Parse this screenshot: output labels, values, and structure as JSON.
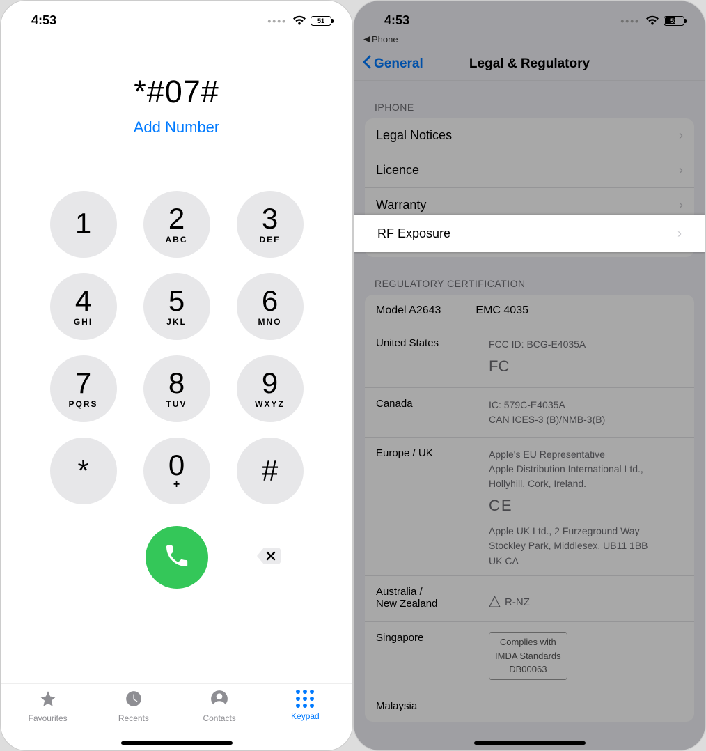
{
  "status": {
    "time": "4:53",
    "battery_pct": "51"
  },
  "dialer": {
    "entered_number": "*#07#",
    "add_number_label": "Add Number",
    "keys": [
      {
        "digit": "1",
        "letters": ""
      },
      {
        "digit": "2",
        "letters": "ABC"
      },
      {
        "digit": "3",
        "letters": "DEF"
      },
      {
        "digit": "4",
        "letters": "GHI"
      },
      {
        "digit": "5",
        "letters": "JKL"
      },
      {
        "digit": "6",
        "letters": "MNO"
      },
      {
        "digit": "7",
        "letters": "PQRS"
      },
      {
        "digit": "8",
        "letters": "TUV"
      },
      {
        "digit": "9",
        "letters": "WXYZ"
      },
      {
        "digit": "*",
        "letters": ""
      },
      {
        "digit": "0",
        "letters": "+"
      },
      {
        "digit": "#",
        "letters": ""
      }
    ],
    "tabs": {
      "favourites": "Favourites",
      "recents": "Recents",
      "contacts": "Contacts",
      "keypad": "Keypad"
    }
  },
  "settings": {
    "back_app": "Phone",
    "nav_back": "General",
    "title": "Legal & Regulatory",
    "section_iphone": "IPHONE",
    "iphone_group": {
      "legal_notices": "Legal Notices",
      "licence": "Licence",
      "warranty": "Warranty",
      "rf_exposure": "RF Exposure"
    },
    "section_reg": "REGULATORY CERTIFICATION",
    "model": "Model A2643",
    "emc": "EMC 4035",
    "reg": {
      "us": {
        "label": "United States",
        "value": "FCC ID: BCG-E4035A",
        "symbol": "FC"
      },
      "canada": {
        "label": "Canada",
        "value1": "IC: 579C-E4035A",
        "value2": "CAN ICES-3 (B)/NMB-3(B)"
      },
      "europe": {
        "label": "Europe / UK",
        "rep1": "Apple's EU Representative",
        "rep2": "Apple Distribution International Ltd.,",
        "rep3": "Hollyhill, Cork, Ireland.",
        "uk1": "Apple UK Ltd., 2 Furzeground Way",
        "uk2": "Stockley Park, Middlesex, UB11 1BB",
        "ce": "CE",
        "ukca": "UK CA"
      },
      "anz": {
        "label1": "Australia /",
        "label2": "New Zealand",
        "symbol": "R-NZ"
      },
      "singapore": {
        "label": "Singapore",
        "box1": "Complies with",
        "box2": "IMDA Standards",
        "box3": "DB00063"
      },
      "malaysia": {
        "label": "Malaysia"
      }
    }
  }
}
